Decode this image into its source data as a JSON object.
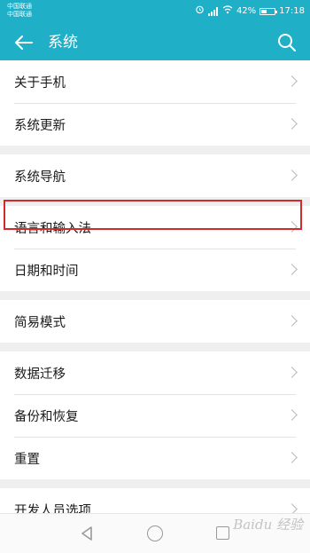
{
  "status_bar": {
    "carrier_1": "中国联通",
    "carrier_2": "中国联通",
    "battery_text": "42%",
    "battery_level": 0.42,
    "time": "17:18",
    "icons": [
      "alarm-icon",
      "signal-icon",
      "wifi-icon",
      "battery-icon"
    ]
  },
  "app_bar": {
    "title": "系统",
    "back_icon": "arrow-left-icon",
    "search_icon": "search-icon"
  },
  "settings_groups": [
    {
      "items": [
        {
          "label": "关于手机"
        },
        {
          "label": "系统更新"
        }
      ]
    },
    {
      "items": [
        {
          "label": "系统导航"
        }
      ]
    },
    {
      "items": [
        {
          "label": "语言和输入法",
          "highlighted": true
        },
        {
          "label": "日期和时间"
        }
      ]
    },
    {
      "items": [
        {
          "label": "简易模式"
        }
      ]
    },
    {
      "items": [
        {
          "label": "数据迁移"
        },
        {
          "label": "备份和恢复"
        },
        {
          "label": "重置"
        }
      ]
    },
    {
      "items": [
        {
          "label": "开发人员选项"
        }
      ]
    }
  ],
  "watermark": "Baidu 经验",
  "nav_bar": {
    "icons": [
      "back-triangle-icon",
      "home-circle-icon",
      "recent-square-icon"
    ]
  },
  "colors": {
    "accent": "#1fb0c8",
    "highlight_border": "#d32b2b",
    "background": "#efefef",
    "row_background": "#ffffff"
  }
}
